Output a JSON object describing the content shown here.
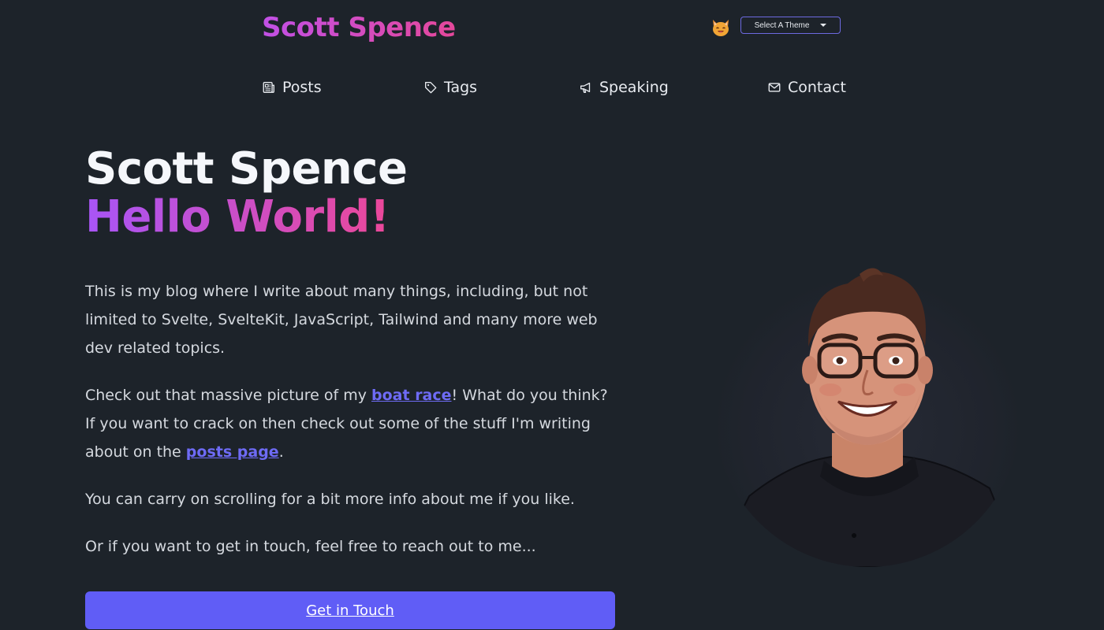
{
  "header": {
    "site_title": "Scott Spence",
    "theme_emoji": "cat-face",
    "theme_select_label": "Select A Theme"
  },
  "nav": {
    "posts": "Posts",
    "tags": "Tags",
    "speaking": "Speaking",
    "contact": "Contact"
  },
  "hero": {
    "name": "Scott Spence",
    "greeting": "Hello World!"
  },
  "intro": {
    "p1": "This is my blog where I write about many things, including, but not limited to Svelte, SvelteKit, JavaScript, Tailwind and many more web dev related topics.",
    "p2_before": "Check out that massive picture of my ",
    "p2_link1": "boat race",
    "p2_middle": "! What do you think? If you want to crack on then check out some of the stuff I'm writing about on the ",
    "p2_link2": "posts page",
    "p2_after": ".",
    "p3": "You can carry on scrolling for a bit more info about me if you like.",
    "p4": "Or if you want to get in touch, feel free to reach out to me..."
  },
  "cta": {
    "label": "Get in Touch"
  },
  "colors": {
    "background": "#1d232a",
    "accent": "#605df6",
    "link": "#6e6bf5",
    "gradient_start": "#a855f7",
    "gradient_end": "#ec4899"
  }
}
